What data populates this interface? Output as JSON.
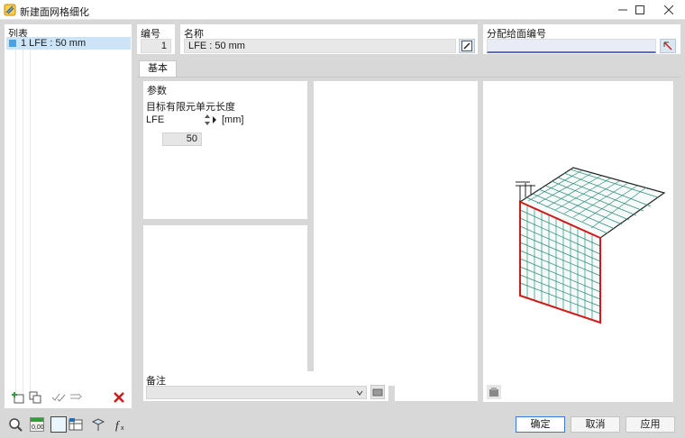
{
  "window": {
    "title": "新建面网格细化"
  },
  "list": {
    "header": "列表",
    "items": [
      {
        "label": "1 LFE : 50 mm"
      }
    ]
  },
  "fields": {
    "number_label": "编号",
    "number_value": "1",
    "name_label": "名称",
    "name_value": "LFE : 50 mm",
    "assign_label": "分配给面编号",
    "assign_value": ""
  },
  "tabs": [
    {
      "label": "基本"
    }
  ],
  "params": {
    "section_label": "参数",
    "target_label": "目标有限元单元长度",
    "lfe_label": "LFE",
    "lfe_value": "50",
    "lfe_unit": "[mm]"
  },
  "comment": {
    "label": "备注",
    "value": ""
  },
  "buttons": {
    "ok": "确定",
    "cancel": "取消",
    "apply": "应用"
  },
  "icons": [
    "new-item-icon",
    "copy-item-icon",
    "check-all-icon",
    "uncheck-icon",
    "delete-icon",
    "search-icon",
    "number-format-icon",
    "color-swatch-icon",
    "table-icon",
    "model-icon",
    "formula-icon",
    "edit-icon",
    "pick-icon",
    "library-icon",
    "view-settings-icon"
  ],
  "colors": {
    "accent": "#4aa3df",
    "delete": "#d11a1a",
    "plate_edge": "#d11a1a",
    "mesh": "#2e8b7a"
  }
}
